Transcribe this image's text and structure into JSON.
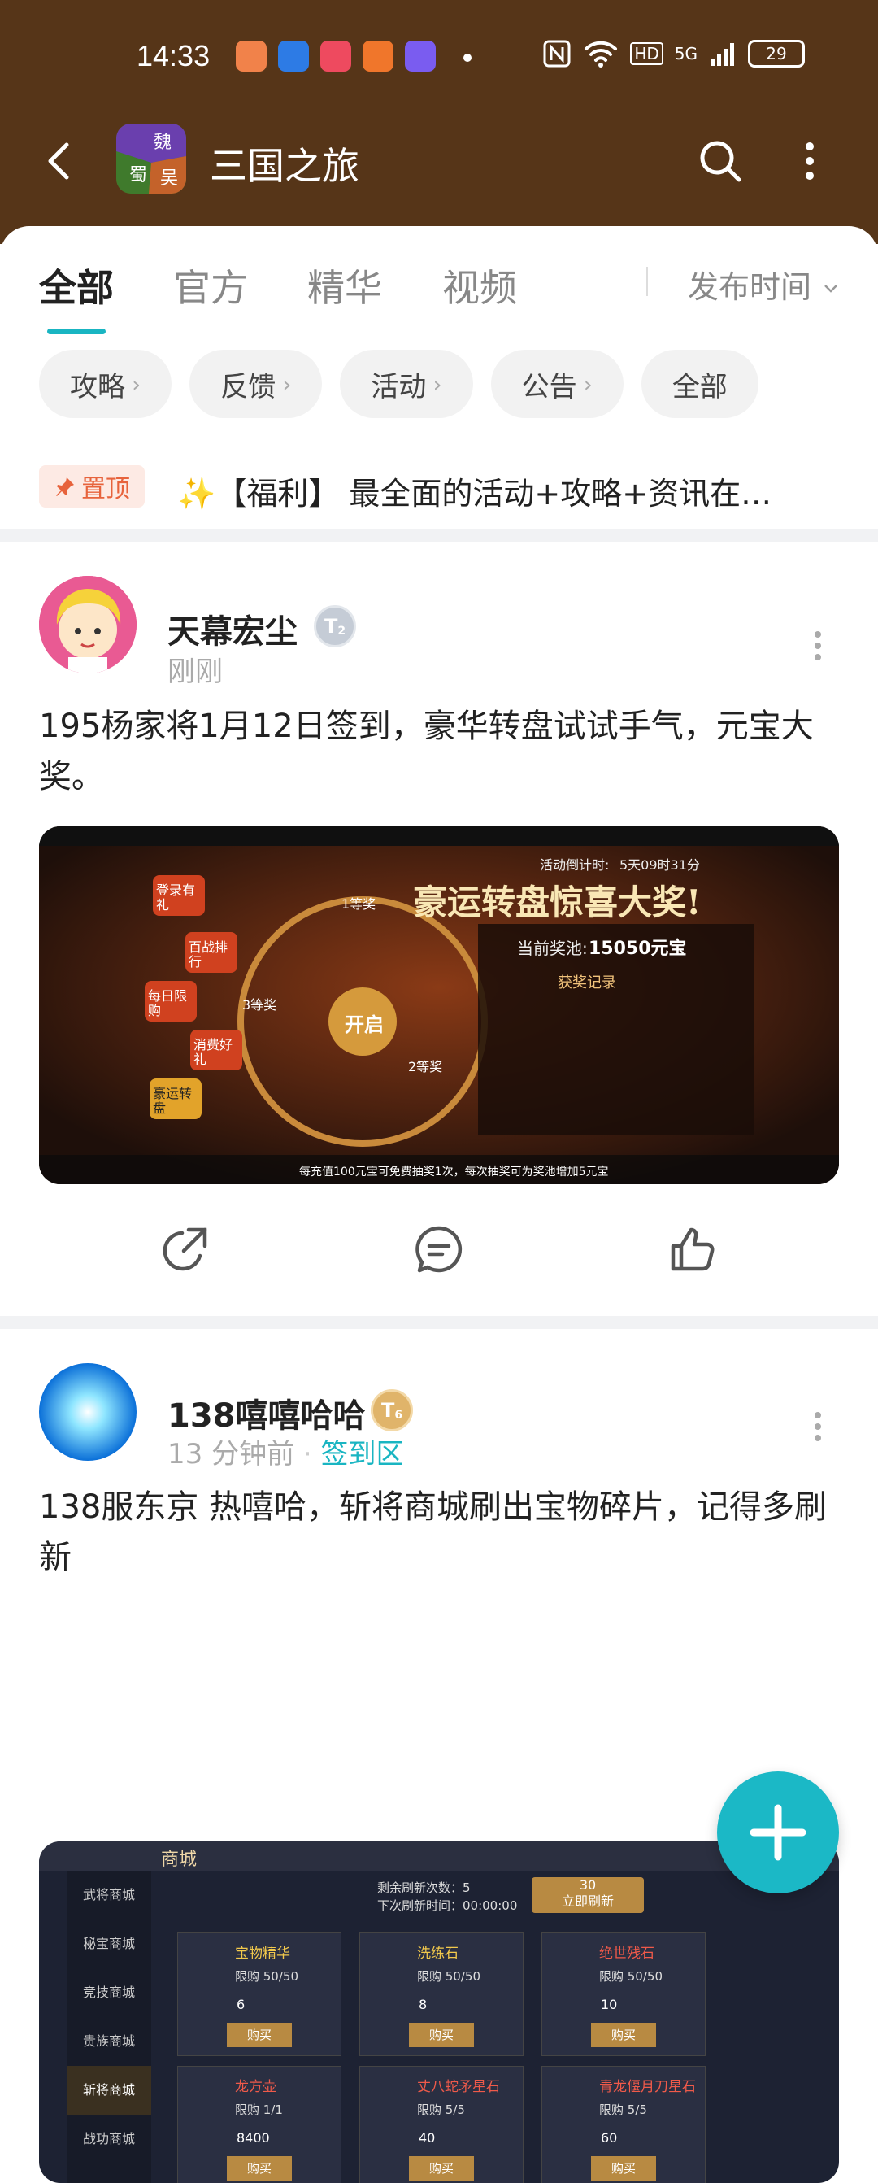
{
  "status_bar": {
    "time": "14:33",
    "network": "5G",
    "hd": "HD",
    "battery": "29"
  },
  "header": {
    "title": "三国之旅"
  },
  "tabs": [
    {
      "label": "全部"
    },
    {
      "label": "官方"
    },
    {
      "label": "精华"
    },
    {
      "label": "视频"
    }
  ],
  "sort": {
    "label": "发布时间"
  },
  "chips": [
    {
      "label": "攻略",
      "arrow": "›"
    },
    {
      "label": "反馈",
      "arrow": "›"
    },
    {
      "label": "活动",
      "arrow": "›"
    },
    {
      "label": "公告",
      "arrow": "›"
    },
    {
      "label": "全部",
      "arrow": ""
    }
  ],
  "pinned": {
    "badge": "置顶",
    "text": "✨【福利】 最全面的活动+攻略+资讯在…"
  },
  "posts": [
    {
      "username": "天幕宏尘",
      "level_badge": "T",
      "level_num": "2",
      "time": "刚刚",
      "zone": "",
      "text": "195杨家将1月12日签到，豪华转盘试试手气，元宝大奖。",
      "image": {
        "banner": "豪运转盘惊喜大奖!",
        "countdown_label": "活动倒计时:",
        "countdown": "5天09时31分",
        "pool_label": "当前奖池:",
        "pool_value": "15050元宝",
        "record_title": "获奖记录",
        "prize1": "1等奖",
        "prize2": "2等奖",
        "prize3": "3等奖",
        "start": "开启",
        "bottom_note": "每充值100元宝可免费抽奖1次，每次抽奖可为奖池增加5元宝",
        "side_menu": [
          "登录有礼",
          "百战排行",
          "每日限购",
          "消费好礼",
          "豪运转盘"
        ]
      }
    },
    {
      "username": "138嘻嘻哈哈",
      "level_badge": "T",
      "level_num": "6",
      "time": "13 分钟前",
      "zone": "签到区",
      "text": "138服东京 热嘻哈，斩将商城刷出宝物碎片，记得多刷新",
      "image": {
        "title": "商城",
        "refresh_count": "剩余刷新次数：5",
        "refresh_time": "下次刷新时间：00:00:00",
        "refresh_btn": "立即刷新",
        "refresh_cost": "30",
        "menu": [
          "武将商城",
          "秘宝商城",
          "竞技商城",
          "贵族商城",
          "斩将商城",
          "战功商城"
        ],
        "items": [
          {
            "name": "宝物精华",
            "limit": "限购 50/50",
            "price": "6",
            "btn": "购买"
          },
          {
            "name": "洗练石",
            "limit": "限购 50/50",
            "price": "8",
            "btn": "购买"
          },
          {
            "name": "绝世残石",
            "limit": "限购 50/50",
            "price": "10",
            "btn": "购买"
          },
          {
            "name": "龙方壶",
            "limit": "限购 1/1",
            "price": "8400",
            "btn": "购买"
          },
          {
            "name": "丈八蛇矛星石",
            "limit": "限购 5/5",
            "price": "40",
            "btn": "购买"
          },
          {
            "name": "青龙偃月刀星石",
            "limit": "限购 5/5",
            "price": "60",
            "btn": "购买"
          }
        ]
      }
    }
  ],
  "colors": {
    "header_bg": "#563518",
    "accent": "#19b5c2",
    "pin": "#e7633c"
  }
}
